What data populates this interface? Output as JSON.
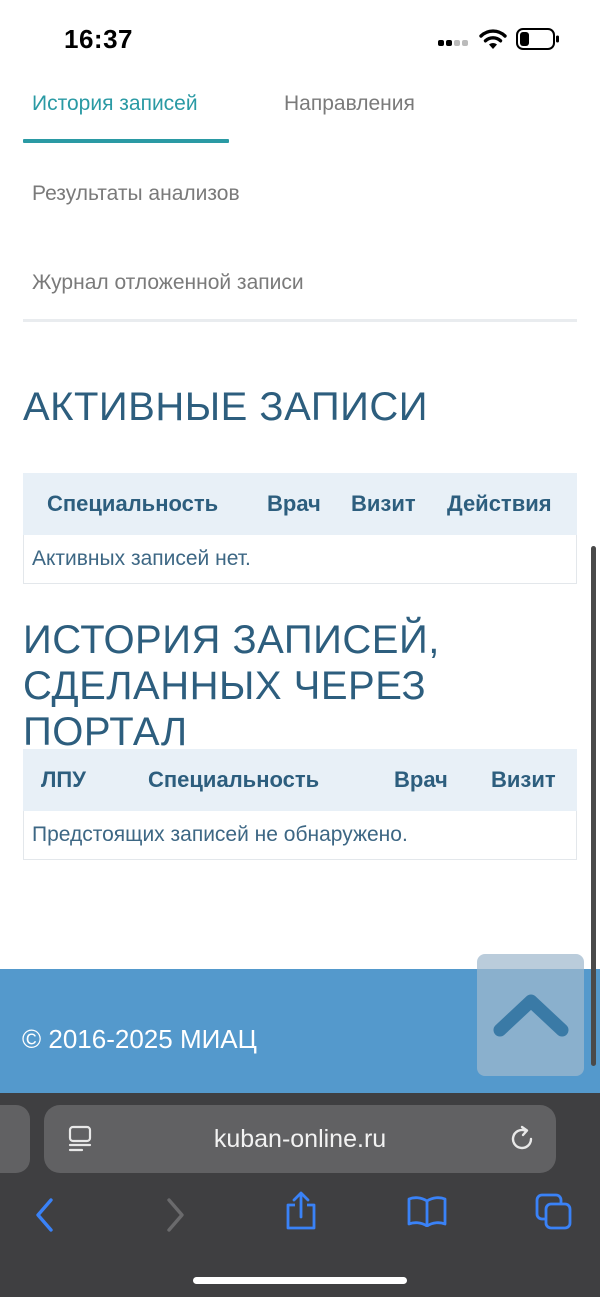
{
  "status_bar": {
    "time": "16:37"
  },
  "tabs": [
    {
      "label": "История записей",
      "active": true
    },
    {
      "label": "Направления",
      "active": false
    },
    {
      "label": "Результаты анализов",
      "active": false
    },
    {
      "label": "Журнал отложенной записи",
      "active": false
    }
  ],
  "active_section": {
    "title": "АКТИВНЫЕ ЗАПИСИ",
    "columns": [
      "Специальность",
      "Врач",
      "Визит",
      "Действия"
    ],
    "empty_message": "Активных записей нет."
  },
  "history_section": {
    "title_line1": "ИСТОРИЯ ЗАПИСЕЙ,",
    "title_line2": "СДЕЛАННЫХ ЧЕРЕЗ ПОРТАЛ",
    "columns": [
      "ЛПУ",
      "Специальность",
      "Врач",
      "Визит"
    ],
    "empty_message": "Предстоящих записей не обнаружено."
  },
  "footer": {
    "copyright": "© 2016-2025 МИАЦ"
  },
  "browser": {
    "url": "kuban-online.ru"
  },
  "colors": {
    "accent": "#2a9aa4",
    "heading": "#2d5e7e",
    "footer_bg": "#5499cc",
    "browser_blue": "#3a82f7"
  },
  "icons": {
    "scroll_top": "chevron-up-icon",
    "page_menu": "page-menu-icon",
    "reload": "reload-icon",
    "back": "chevron-left-icon",
    "forward": "chevron-right-icon",
    "share": "share-icon",
    "bookmarks": "book-icon",
    "tabs": "tabs-icon"
  }
}
